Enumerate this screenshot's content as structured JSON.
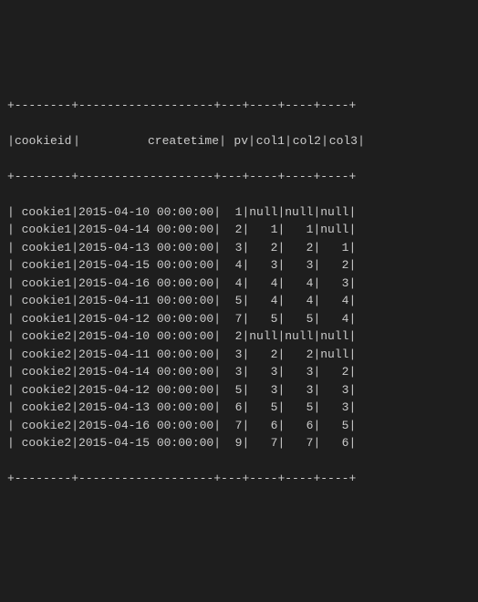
{
  "border": "+--------+-------------------+---+----+----+----+",
  "headers": {
    "cookieid": "cookieid",
    "createtime": "createtime",
    "pv": "pv",
    "col1": "col1",
    "col2": "col2",
    "col3": "col3"
  },
  "chart_data": {
    "type": "table",
    "columns": [
      "cookieid",
      "createtime",
      "pv",
      "col1",
      "col2",
      "col3"
    ],
    "rows": [
      {
        "cookieid": "cookie1",
        "createtime": "2015-04-10 00:00:00",
        "pv": "1",
        "col1": "null",
        "col2": "null",
        "col3": "null"
      },
      {
        "cookieid": "cookie1",
        "createtime": "2015-04-14 00:00:00",
        "pv": "2",
        "col1": "1",
        "col2": "1",
        "col3": "null"
      },
      {
        "cookieid": "cookie1",
        "createtime": "2015-04-13 00:00:00",
        "pv": "3",
        "col1": "2",
        "col2": "2",
        "col3": "1"
      },
      {
        "cookieid": "cookie1",
        "createtime": "2015-04-15 00:00:00",
        "pv": "4",
        "col1": "3",
        "col2": "3",
        "col3": "2"
      },
      {
        "cookieid": "cookie1",
        "createtime": "2015-04-16 00:00:00",
        "pv": "4",
        "col1": "4",
        "col2": "4",
        "col3": "3"
      },
      {
        "cookieid": "cookie1",
        "createtime": "2015-04-11 00:00:00",
        "pv": "5",
        "col1": "4",
        "col2": "4",
        "col3": "4"
      },
      {
        "cookieid": "cookie1",
        "createtime": "2015-04-12 00:00:00",
        "pv": "7",
        "col1": "5",
        "col2": "5",
        "col3": "4"
      },
      {
        "cookieid": "cookie2",
        "createtime": "2015-04-10 00:00:00",
        "pv": "2",
        "col1": "null",
        "col2": "null",
        "col3": "null"
      },
      {
        "cookieid": "cookie2",
        "createtime": "2015-04-11 00:00:00",
        "pv": "3",
        "col1": "2",
        "col2": "2",
        "col3": "null"
      },
      {
        "cookieid": "cookie2",
        "createtime": "2015-04-14 00:00:00",
        "pv": "3",
        "col1": "3",
        "col2": "3",
        "col3": "2"
      },
      {
        "cookieid": "cookie2",
        "createtime": "2015-04-12 00:00:00",
        "pv": "5",
        "col1": "3",
        "col2": "3",
        "col3": "3"
      },
      {
        "cookieid": "cookie2",
        "createtime": "2015-04-13 00:00:00",
        "pv": "6",
        "col1": "5",
        "col2": "5",
        "col3": "3"
      },
      {
        "cookieid": "cookie2",
        "createtime": "2015-04-16 00:00:00",
        "pv": "7",
        "col1": "6",
        "col2": "6",
        "col3": "5"
      },
      {
        "cookieid": "cookie2",
        "createtime": "2015-04-15 00:00:00",
        "pv": "9",
        "col1": "7",
        "col2": "7",
        "col3": "6"
      }
    ]
  }
}
